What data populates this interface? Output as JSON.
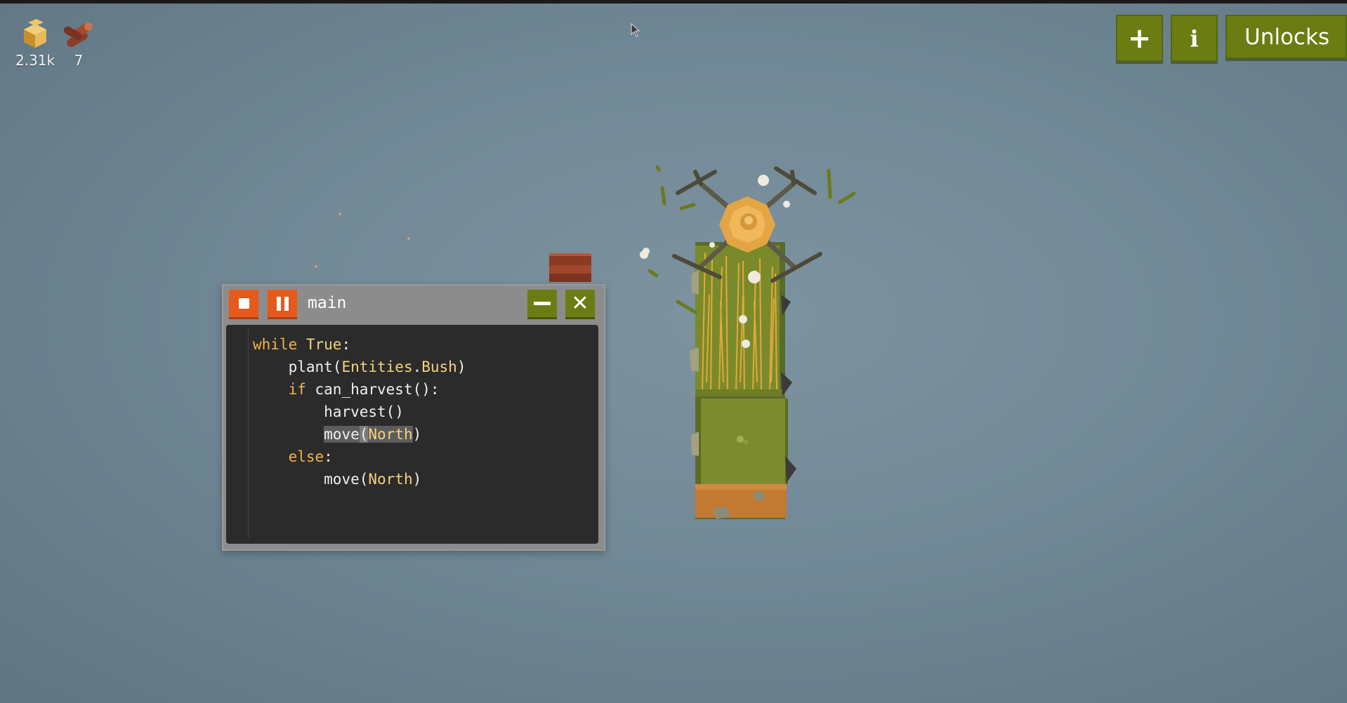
{
  "resources": [
    {
      "name": "hay",
      "icon": "hay-icon",
      "count": "2.31k"
    },
    {
      "name": "wood",
      "icon": "wood-icon",
      "count": "7"
    }
  ],
  "toolbar": {
    "plus_icon": "plus-icon",
    "info_label": "i",
    "unlocks_label": "Unlocks"
  },
  "code_window": {
    "title": "main",
    "stop_icon": "stop-icon",
    "pause_icon": "pause-icon",
    "minimize_icon": "minimize-icon",
    "close_icon": "close-icon",
    "lines": [
      {
        "indent": "",
        "tokens": [
          [
            "kw",
            "while"
          ],
          [
            "txt",
            " "
          ],
          [
            "ty",
            "True"
          ],
          [
            "txt",
            ":"
          ]
        ]
      },
      {
        "indent": "    ",
        "tokens": [
          [
            "txt",
            "plant("
          ],
          [
            "ty",
            "Entities"
          ],
          [
            "txt",
            "."
          ],
          [
            "ty",
            "Bush"
          ],
          [
            "txt",
            ")"
          ]
        ]
      },
      {
        "indent": "    ",
        "tokens": [
          [
            "kw",
            "if"
          ],
          [
            "txt",
            " can_harvest():"
          ]
        ]
      },
      {
        "indent": "        ",
        "tokens": [
          [
            "txt",
            "harvest()"
          ]
        ]
      },
      {
        "indent": "        ",
        "tokens": [
          [
            "sel",
            "move"
          ],
          [
            "caret",
            "("
          ],
          [
            "selty",
            "North"
          ],
          [
            "txt",
            ")"
          ]
        ]
      },
      {
        "indent": "    ",
        "tokens": [
          [
            "kw",
            "else"
          ],
          [
            "txt",
            ":"
          ]
        ]
      },
      {
        "indent": "        ",
        "tokens": [
          [
            "txt",
            "move("
          ],
          [
            "ty",
            "North"
          ],
          [
            "txt",
            ")"
          ]
        ]
      }
    ]
  },
  "colors": {
    "background": "#718896",
    "button_green": "#6b7d12",
    "button_orange": "#e55a1b",
    "editor_bg": "#2b2b2b",
    "keyword": "#f2b24a"
  },
  "scene": {
    "objects": [
      "drone",
      "wheat-field",
      "grass-tile",
      "dirt-tile",
      "wood-stack"
    ]
  }
}
